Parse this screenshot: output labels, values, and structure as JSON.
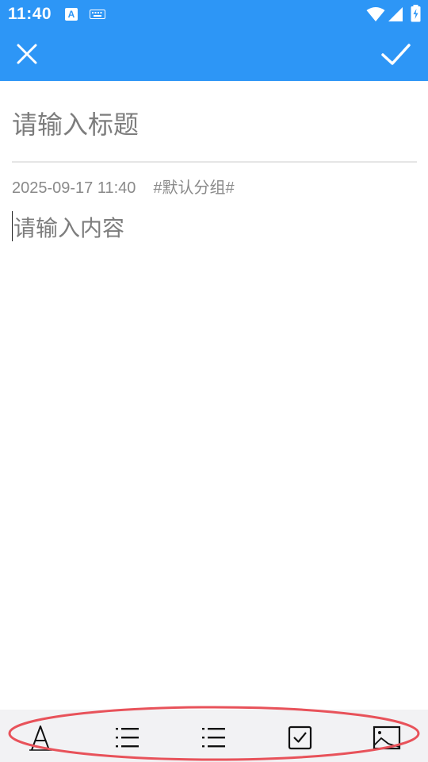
{
  "status_bar": {
    "time": "11:40",
    "indicator_letter": "A",
    "icons": [
      "keyboard-icon",
      "wifi-icon",
      "signal-icon",
      "battery-icon"
    ]
  },
  "header": {
    "close_icon": "close-icon",
    "confirm_icon": "check-icon",
    "background_color": "#2d96f6"
  },
  "editor": {
    "title_placeholder": "请输入标题",
    "timestamp": "2025-09-17 11:40",
    "group_tag": "#默认分组#",
    "content_placeholder": "请输入内容"
  },
  "toolbar": {
    "tools": [
      {
        "icon": "text-format-icon"
      },
      {
        "icon": "bulleted-list-icon"
      },
      {
        "icon": "numbered-list-icon"
      },
      {
        "icon": "checkbox-icon"
      },
      {
        "icon": "image-icon"
      }
    ],
    "highlight_color": "#e8525a"
  }
}
